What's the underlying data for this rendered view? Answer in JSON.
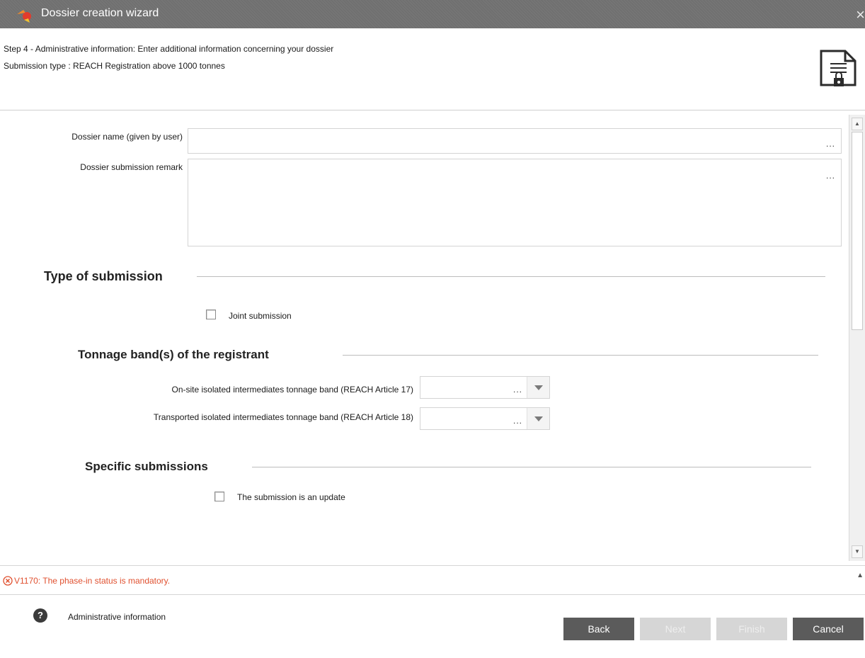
{
  "window": {
    "title": "Dossier creation wizard",
    "close_glyph": "×"
  },
  "header": {
    "step_text": "Step 4 - Administrative information: Enter additional information concerning your dossier",
    "submission_type_text": "Submission type : REACH Registration above 1000 tonnes",
    "icon": "document-lock-icon"
  },
  "form": {
    "dossier_name": {
      "label": "Dossier name (given by user)",
      "value": "",
      "more": "..."
    },
    "submission_remark": {
      "label": "Dossier submission remark",
      "value": "",
      "more": "..."
    },
    "type_of_submission": {
      "heading": "Type of submission",
      "joint_submission": {
        "label": "Joint submission",
        "checked": false
      }
    },
    "tonnage": {
      "heading": "Tonnage band(s) of the registrant",
      "onsite": {
        "label": "On-site isolated intermediates tonnage band (REACH Article 17)",
        "value": "",
        "more": "..."
      },
      "transported": {
        "label": "Transported isolated intermediates tonnage band (REACH Article 18)",
        "value": "",
        "more": "..."
      }
    },
    "specific": {
      "heading": "Specific submissions",
      "update": {
        "label": "The submission is an update",
        "checked": false
      }
    }
  },
  "validation": {
    "message": "V1170: The phase-in status is mandatory.",
    "color": "#e0502f",
    "icon": "error-circle-icon"
  },
  "footer": {
    "help_glyph": "?",
    "page_label": "Administrative information",
    "buttons": {
      "back": "Back",
      "next": "Next",
      "finish": "Finish",
      "cancel": "Cancel"
    }
  },
  "colors": {
    "titlebar": "#707070",
    "button_dark": "#5b5b5b",
    "button_disabled": "#d6d6d6"
  }
}
